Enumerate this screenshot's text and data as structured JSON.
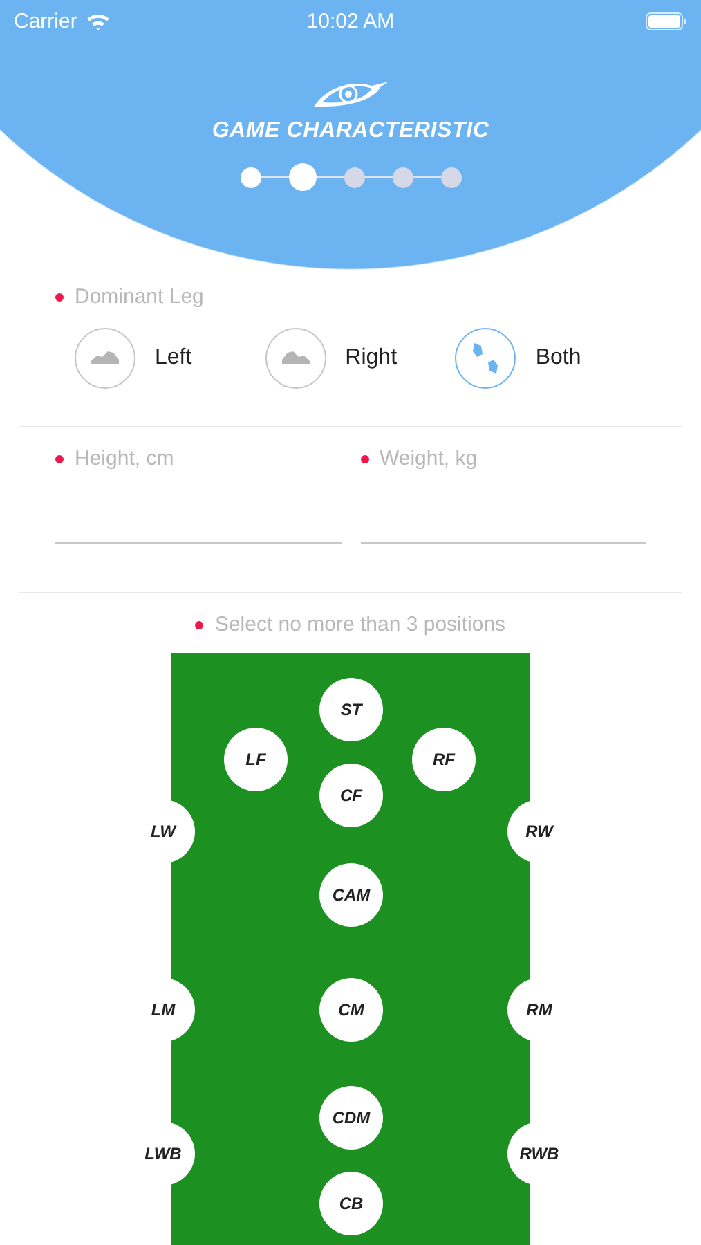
{
  "status_bar": {
    "carrier": "Carrier",
    "time": "10:02 AM"
  },
  "header": {
    "title": "GAME CHARACTERISTIC"
  },
  "steps": [
    {
      "selected": false,
      "done": true
    },
    {
      "selected": true,
      "done": true
    },
    {
      "selected": false,
      "done": false
    },
    {
      "selected": false,
      "done": false
    },
    {
      "selected": false,
      "done": false
    }
  ],
  "dominant_leg": {
    "label": "Dominant Leg",
    "required": true,
    "options": [
      {
        "label": "Left",
        "kind": "left",
        "selected": false
      },
      {
        "label": "Right",
        "kind": "right",
        "selected": false
      },
      {
        "label": "Both",
        "kind": "both",
        "selected": true
      }
    ]
  },
  "fields": [
    {
      "label": "Height, cm",
      "required": true
    },
    {
      "label": "Weight, kg",
      "required": true
    }
  ],
  "positions": {
    "label": "Select no more than 3 positions",
    "required": true,
    "items": [
      {
        "label": "ST",
        "selected": false
      },
      {
        "label": "LF",
        "selected": false
      },
      {
        "label": "RF",
        "selected": false
      },
      {
        "label": "CF",
        "selected": false
      },
      {
        "label": "LW",
        "selected": false
      },
      {
        "label": "RW",
        "selected": false
      },
      {
        "label": "CAM",
        "selected": false
      },
      {
        "label": "LM",
        "selected": false
      },
      {
        "label": "CM",
        "selected": false
      },
      {
        "label": "RM",
        "selected": false
      },
      {
        "label": "CDM",
        "selected": false
      },
      {
        "label": "LWB",
        "selected": false
      },
      {
        "label": "RWB",
        "selected": false
      },
      {
        "label": "CB",
        "selected": false
      }
    ]
  }
}
